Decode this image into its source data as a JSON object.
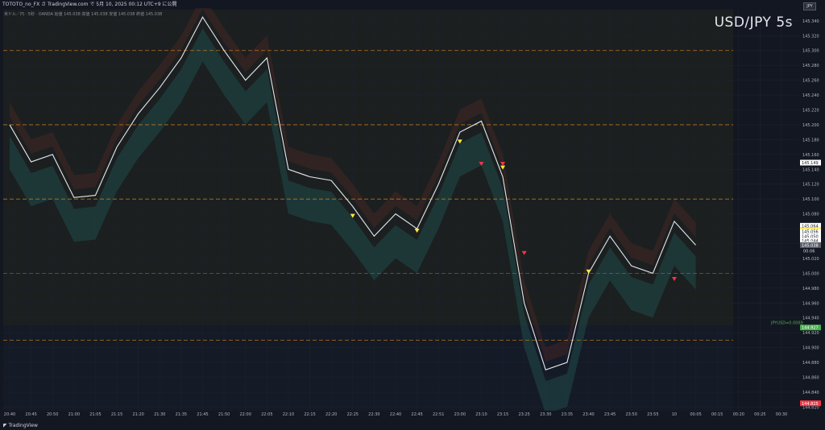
{
  "header": {
    "title": "TOTOTO_no_FX さ TradingView.com で 5月 10, 2025 00:12 UTC+9 に公開",
    "ohlc": "米ドル／円 · 5秒 · OANDA  始値 145.038  高値 145.038  安値 145.038  終値 145.038",
    "currency": "JPY"
  },
  "footer": {
    "brand": "TradingView"
  },
  "chart_data": {
    "type": "line",
    "title": "USD/JPY 5s",
    "ylim": [
      144.815,
      145.355
    ],
    "yticks": [
      145.34,
      145.32,
      145.3,
      145.28,
      145.26,
      145.24,
      145.22,
      145.2,
      145.18,
      145.16,
      145.14,
      145.12,
      145.1,
      145.08,
      145.06,
      145.04,
      145.02,
      145.0,
      144.98,
      144.96,
      144.94,
      144.92,
      144.9,
      144.88,
      144.86,
      144.84,
      144.82
    ],
    "xticks": [
      "20:40",
      "20:45",
      "20:50",
      "21:00",
      "21:05",
      "21:15",
      "21:20",
      "21:30",
      "21:35",
      "21:45",
      "21:50",
      "22:00",
      "22:05",
      "22:10",
      "22:15",
      "22:20",
      "22:25",
      "22:30",
      "22:40",
      "22:45",
      "22:51",
      "23:00",
      "23:10",
      "23:15",
      "23:25",
      "23:30",
      "23:35",
      "23:40",
      "23:45",
      "23:50",
      "23:55",
      "10",
      "00:05",
      "00:15",
      "00:20",
      "00:25",
      "00:30"
    ],
    "price_series": [
      {
        "t": "20:40",
        "v": 145.2
      },
      {
        "t": "20:45",
        "v": 145.15
      },
      {
        "t": "20:50",
        "v": 145.16
      },
      {
        "t": "21:00",
        "v": 145.102
      },
      {
        "t": "21:05",
        "v": 145.105
      },
      {
        "t": "21:15",
        "v": 145.17
      },
      {
        "t": "21:20",
        "v": 145.215
      },
      {
        "t": "21:30",
        "v": 145.25
      },
      {
        "t": "21:35",
        "v": 145.29
      },
      {
        "t": "21:45",
        "v": 145.345
      },
      {
        "t": "21:50",
        "v": 145.3
      },
      {
        "t": "22:00",
        "v": 145.26
      },
      {
        "t": "22:05",
        "v": 145.29
      },
      {
        "t": "22:10",
        "v": 145.14
      },
      {
        "t": "22:15",
        "v": 145.13
      },
      {
        "t": "22:20",
        "v": 145.125
      },
      {
        "t": "22:25",
        "v": 145.09
      },
      {
        "t": "22:30",
        "v": 145.05
      },
      {
        "t": "22:40",
        "v": 145.08
      },
      {
        "t": "22:45",
        "v": 145.06
      },
      {
        "t": "22:51",
        "v": 145.12
      },
      {
        "t": "23:00",
        "v": 145.19
      },
      {
        "t": "23:10",
        "v": 145.205
      },
      {
        "t": "23:15",
        "v": 145.13
      },
      {
        "t": "23:25",
        "v": 144.96
      },
      {
        "t": "23:30",
        "v": 144.87
      },
      {
        "t": "23:35",
        "v": 144.88
      },
      {
        "t": "23:40",
        "v": 145.0
      },
      {
        "t": "23:45",
        "v": 145.05
      },
      {
        "t": "23:50",
        "v": 145.01
      },
      {
        "t": "23:55",
        "v": 145.0
      },
      {
        "t": "10",
        "v": 145.07
      },
      {
        "t": "00:05",
        "v": 145.038
      }
    ],
    "last_price": 145.038,
    "last_time_label": "00:06",
    "price_labels": [
      {
        "v": 145.149,
        "text": "145.149",
        "bg": "#ffffff",
        "fg": "#131722"
      },
      {
        "v": 145.064,
        "text": "145.064",
        "bg": "#ffffff",
        "fg": "#131722"
      },
      {
        "v": 145.058,
        "text": "145.058",
        "bg": "#ffeb3b",
        "fg": "#131722"
      },
      {
        "v": 145.056,
        "text": "145.056",
        "bg": "#ffffff",
        "fg": "#131722"
      },
      {
        "v": 145.05,
        "text": "145.050",
        "bg": "#ffffff",
        "fg": "#131722"
      },
      {
        "v": 145.044,
        "text": "145.044",
        "bg": "#ffffff",
        "fg": "#131722"
      },
      {
        "v": 145.039,
        "text": "145.039",
        "bg": "#ffffff",
        "fg": "#131722"
      },
      {
        "v": 145.038,
        "text": "145.038",
        "bg": "#5d606b",
        "fg": "#ffffff"
      },
      {
        "v": 144.927,
        "text": "144.927",
        "bg": "#4caf50",
        "fg": "#ffffff"
      },
      {
        "v": 144.825,
        "text": "144.825",
        "bg": "#f23645",
        "fg": "#ffffff"
      }
    ],
    "annotation": {
      "text": "JPYUSD=0.0069",
      "v": 144.927,
      "color": "#4caf50"
    },
    "levels": [
      {
        "v": 145.2,
        "color": "#e08a1a"
      },
      {
        "v": 145.1,
        "color": "#e08a1a"
      },
      {
        "v": 145.3,
        "color": "#e08a1a"
      },
      {
        "v": 145.0,
        "color": "#e04040"
      },
      {
        "v": 144.91,
        "color": "#e08a1a"
      }
    ],
    "buy_signals": [
      {
        "t": "22:25",
        "v": 145.08
      },
      {
        "t": "22:45",
        "v": 145.06
      },
      {
        "t": "23:00",
        "v": 145.18
      },
      {
        "t": "23:40",
        "v": 145.005
      },
      {
        "t": "23:15",
        "v": 145.145
      }
    ],
    "sell_signals": [
      {
        "t": "23:10",
        "v": 145.15
      },
      {
        "t": "23:15",
        "v": 145.15
      },
      {
        "t": "23:25",
        "v": 145.03
      },
      {
        "t": "10",
        "v": 144.995
      }
    ],
    "grid": true,
    "colors": {
      "background": "#131722",
      "up": "#e6e8ec",
      "cloud_bull": "#1f4a4a",
      "cloud_bear": "#5a2a25",
      "axis_text": "#b2b5be"
    }
  }
}
